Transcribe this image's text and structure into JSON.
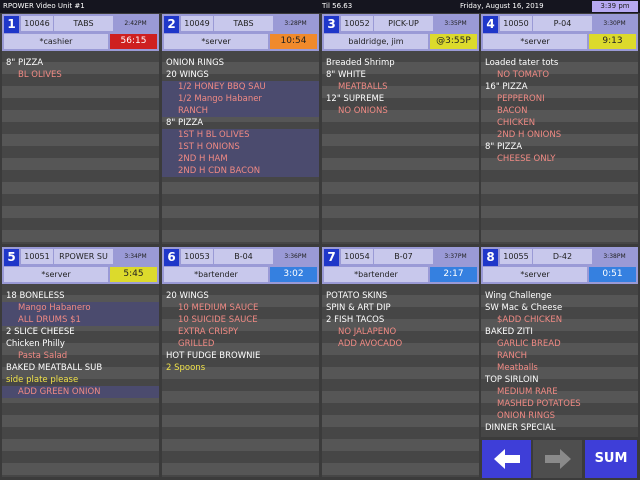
{
  "topbar": {
    "app_title": "RPOWER Video Unit #1",
    "til": "Til 56.63",
    "date": "Friday, August 16, 2019",
    "time": "3:39 pm"
  },
  "tickets": [
    {
      "num": "1",
      "check": "10046",
      "type": "TABS",
      "time": "2:42PM",
      "server": "*cashier",
      "timer": "56:15",
      "items": [
        {
          "text": "8\" PIZZA"
        },
        {
          "text": "BL OLIVES"
        }
      ]
    },
    {
      "num": "2",
      "check": "10049",
      "type": "TABS",
      "time": "3:28PM",
      "server": "*server",
      "timer": "10:54",
      "items": [
        {
          "text": "ONION RINGS"
        },
        {
          "text": "20 WINGS"
        },
        {
          "text": "1/2 HONEY BBQ SAU"
        },
        {
          "text": "1/2 Mango Habaner"
        },
        {
          "text": "RANCH"
        },
        {
          "text": "8\" PIZZA"
        },
        {
          "text": "1ST H BL OLIVES"
        },
        {
          "text": "1ST H ONIONS"
        },
        {
          "text": "2ND H HAM"
        },
        {
          "text": "2ND H CDN BACON"
        }
      ]
    },
    {
      "num": "3",
      "check": "10052",
      "type": "PICK-UP",
      "time": "3:35PM",
      "server": "baldridge, jim",
      "timer": "@3:55P",
      "items": [
        {
          "text": "Breaded Shrimp"
        },
        {
          "text": "8\" WHITE"
        },
        {
          "text": "MEATBALLS"
        },
        {
          "text": "12\" SUPREME"
        },
        {
          "text": "NO ONIONS"
        }
      ]
    },
    {
      "num": "4",
      "check": "10050",
      "type": "P-04",
      "time": "3:30PM",
      "server": "*server",
      "timer": "9:13",
      "items": [
        {
          "text": "Loaded tater tots"
        },
        {
          "text": "NO TOMATO"
        },
        {
          "text": "16\" PIZZA"
        },
        {
          "text": "PEPPERONI"
        },
        {
          "text": "BACON"
        },
        {
          "text": "CHICKEN"
        },
        {
          "text": "2ND H ONIONS"
        },
        {
          "text": "8\" PIZZA"
        },
        {
          "text": "CHEESE ONLY"
        }
      ]
    },
    {
      "num": "5",
      "check": "10051",
      "type": "RPOWER SU",
      "time": "3:34PM",
      "server": "*server",
      "timer": "5:45",
      "items": [
        {
          "text": "18 BONELESS"
        },
        {
          "text": "Mango Habanero"
        },
        {
          "text": "ALL DRUMS $1"
        },
        {
          "text": "2 SLICE CHEESE"
        },
        {
          "text": "Chicken Philly"
        },
        {
          "text": "Pasta Salad"
        },
        {
          "text": "BAKED MEATBALL SUB"
        },
        {
          "text": "side plate please"
        },
        {
          "text": "ADD GREEN ONION"
        }
      ]
    },
    {
      "num": "6",
      "check": "10053",
      "type": "B-04",
      "time": "3:36PM",
      "server": "*bartender",
      "timer": "3:02",
      "items": [
        {
          "text": "20 WINGS"
        },
        {
          "text": "10 MEDIUM SAUCE"
        },
        {
          "text": "10 SUICIDE SAUCE"
        },
        {
          "text": "EXTRA CRISPY"
        },
        {
          "text": "GRILLED"
        },
        {
          "text": "HOT FUDGE BROWNIE"
        },
        {
          "text": "2 Spoons"
        }
      ]
    },
    {
      "num": "7",
      "check": "10054",
      "type": "B-07",
      "time": "3:37PM",
      "server": "*bartender",
      "timer": "2:17",
      "items": [
        {
          "text": "POTATO SKINS"
        },
        {
          "text": "SPIN & ART DIP"
        },
        {
          "text": "2 FISH TACOS"
        },
        {
          "text": "NO JALAPENO"
        },
        {
          "text": "ADD AVOCADO"
        }
      ]
    },
    {
      "num": "8",
      "check": "10055",
      "type": "D-42",
      "time": "3:38PM",
      "server": "*server",
      "timer": "0:51",
      "items": [
        {
          "text": "Wing Challenge"
        },
        {
          "text": "SW Mac & Cheese"
        },
        {
          "text": "$ADD CHICKEN"
        },
        {
          "text": "BAKED ZITI"
        },
        {
          "text": "GARLIC BREAD"
        },
        {
          "text": "RANCH"
        },
        {
          "text": "Meatballs"
        },
        {
          "text": "TOP SIRLOIN"
        },
        {
          "text": "MEDIUM RARE"
        },
        {
          "text": "MASHED POTATOES"
        },
        {
          "text": "ONION RINGS"
        },
        {
          "text": "DINNER SPECIAL"
        }
      ]
    }
  ],
  "nav": {
    "back_icon": "arrow-left-icon",
    "forward_icon": "arrow-right-icon",
    "sum_label": "SUM"
  },
  "colors": {
    "header": "#9a9ad6",
    "number_badge": "#1f37c9",
    "modifier_text": "#f08a84",
    "note_text": "#f0e24a",
    "timer_red": "#ce2020",
    "timer_orange": "#f08a2c",
    "timer_yellow": "#dcda2c",
    "timer_blue": "#3580e0",
    "nav_button": "#3e3ed8"
  }
}
